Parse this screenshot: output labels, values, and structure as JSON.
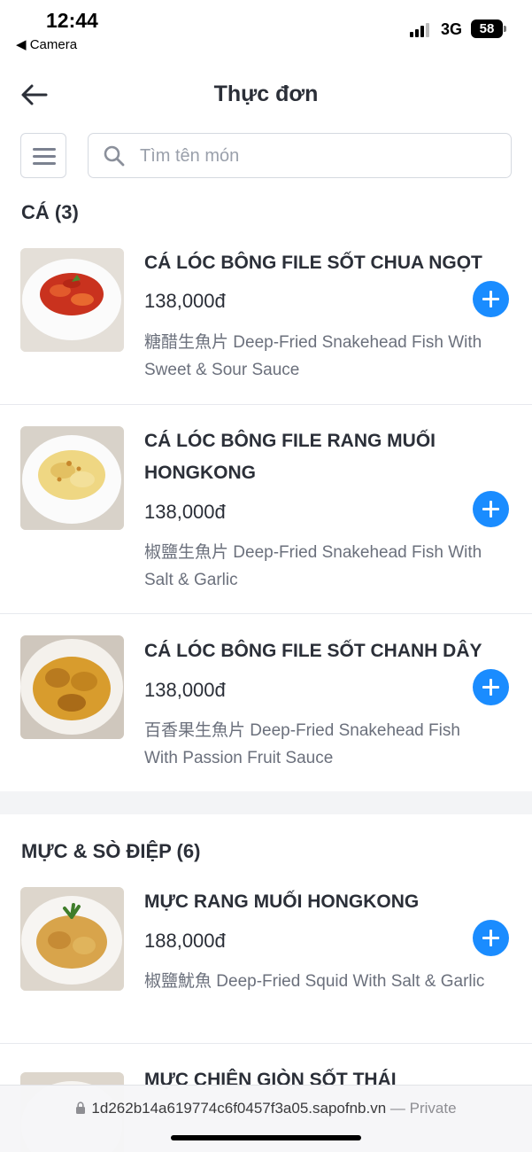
{
  "status_bar": {
    "time": "12:44",
    "back_app": "◀ Camera",
    "network": "3G",
    "battery": "58"
  },
  "header": {
    "title": "Thực đơn"
  },
  "search": {
    "placeholder": "Tìm tên món"
  },
  "colors": {
    "accent": "#1a8cff",
    "text": "#2b2f38",
    "muted": "#6b707c",
    "divider": "#e7e9ee"
  },
  "sections": [
    {
      "title": "CÁ (3)",
      "items": [
        {
          "name": "CÁ LÓC BÔNG FILE SỐT CHUA NGỌT",
          "price": "138,000đ",
          "description": "糖醋生魚片 Deep-Fried Snakehead Fish With Sweet & Sour Sauce",
          "image_icon": "fish-sweet-sour-photo"
        },
        {
          "name": "CÁ LÓC BÔNG FILE RANG MUỐI HONGKONG",
          "price": "138,000đ",
          "description": "椒鹽生魚片 Deep-Fried Snakehead Fish With Salt & Garlic",
          "image_icon": "fish-salt-garlic-photo"
        },
        {
          "name": "CÁ LÓC BÔNG FILE SỐT CHANH DÂY",
          "price": "138,000đ",
          "description": "百香果生魚片 Deep-Fried Snakehead Fish With Passion Fruit Sauce",
          "image_icon": "fish-passion-fruit-photo"
        }
      ]
    },
    {
      "title": "MỰC & SÒ ĐIỆP (6)",
      "items": [
        {
          "name": "MỰC RANG MUỐI HONGKONG",
          "price": "188,000đ",
          "description": "椒鹽魷魚 Deep-Fried Squid With Salt & Garlic",
          "image_icon": "squid-salt-garlic-photo"
        },
        {
          "name": "MỰC CHIÊN GIÒN SỐT THÁI",
          "price": "",
          "description": "",
          "image_icon": "squid-thai-photo"
        }
      ]
    }
  ],
  "browser": {
    "url": "1d262b14a619774c6f0457f3a05.sapofnb.vn",
    "mode": "— Private"
  }
}
